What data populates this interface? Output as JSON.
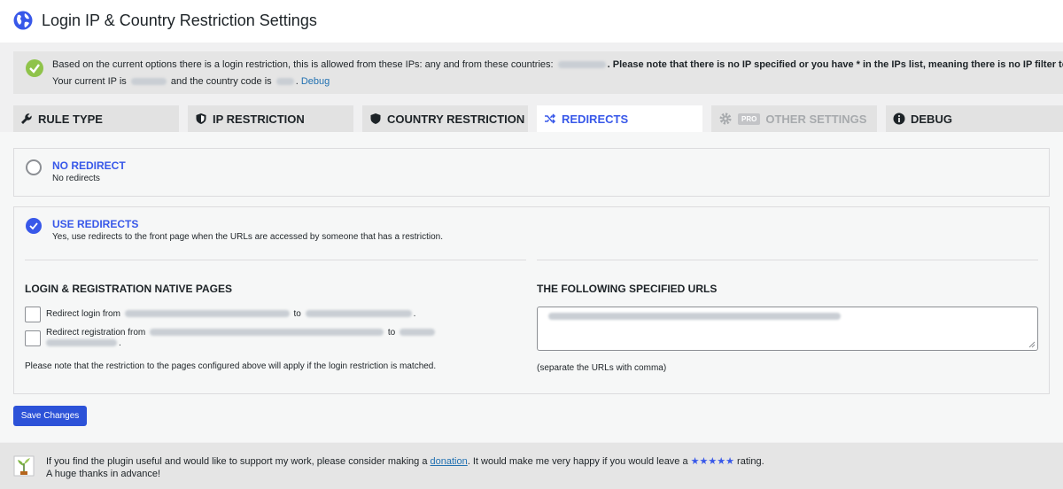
{
  "page": {
    "title": "Login IP & Country Restriction Settings"
  },
  "notice": {
    "line1_prefix": "Based on the current options there is a login restriction, this is allowed from these IPs: any and from these countries:",
    "line1_bold": ". Please note that there is no IP specified or you have * in the IPs list, meaning there is no IP filter to apply.",
    "line2_prefix": "Your current IP is",
    "line2_middle": "and the country code is",
    "line2_link": "Debug"
  },
  "tabs": [
    {
      "label": "RULE TYPE",
      "icon": "wrench-icon"
    },
    {
      "label": "IP RESTRICTION",
      "icon": "shield-half-icon"
    },
    {
      "label": "COUNTRY RESTRICTION",
      "icon": "shield-icon"
    },
    {
      "label": "REDIRECTS",
      "icon": "shuffle-icon",
      "active": true
    },
    {
      "label": "OTHER SETTINGS",
      "icon": "gear-icon",
      "badge": "PRO",
      "disabled": true
    },
    {
      "label": "DEBUG",
      "icon": "info-icon"
    }
  ],
  "options": {
    "no_redirect": {
      "title": "NO REDIRECT",
      "desc": "No redirects",
      "selected": false
    },
    "use_redirects": {
      "title": "USE REDIRECTS",
      "desc": "Yes, use redirects to the front page when the URLs are accessed by someone that has a restriction.",
      "selected": true
    }
  },
  "native_pages": {
    "heading": "LOGIN & REGISTRATION NATIVE PAGES",
    "login_label_prefix": "Redirect login from",
    "login_label_to": "to",
    "register_label_prefix": "Redirect registration from",
    "register_label_to": "to",
    "note": "Please note that the restriction to the pages configured above will apply if the login restriction is matched."
  },
  "specified_urls": {
    "heading": "THE FOLLOWING SPECIFIED URLS",
    "hint": "(separate the URLs with comma)"
  },
  "save_button": "Save Changes",
  "footer": {
    "line1_prefix": "If you find the plugin useful and would like to support my work, please consider making a",
    "link": "donation",
    "line1_middle": ". It would make me very happy if you would leave a",
    "stars": "★★★★★",
    "line1_suffix": "rating.",
    "line2": "A huge thanks in advance!"
  },
  "colors": {
    "accent": "#3858e9",
    "success": "#8fc34a",
    "button": "#2c52d8"
  }
}
